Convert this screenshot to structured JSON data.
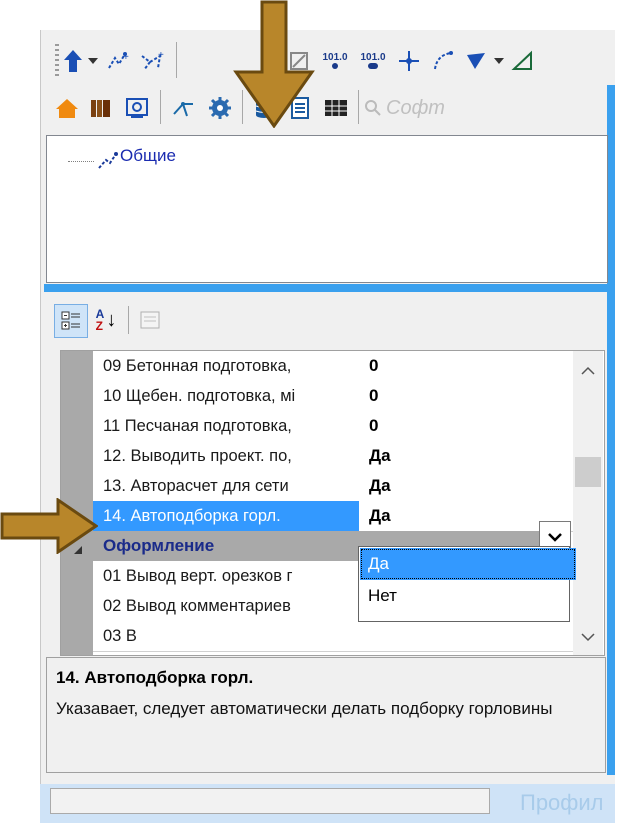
{
  "toolbar1": {
    "items": [
      {
        "icon": "up-arrow-icon"
      },
      {
        "icon": "dropdown-arrow-icon"
      },
      {
        "icon": "network-add-icon"
      },
      {
        "icon": "network-add2-icon"
      },
      {
        "icon": "edit-shape-icon"
      },
      {
        "icon": "label-101-icon",
        "text": "101.0"
      },
      {
        "icon": "label-101-b-icon",
        "text": "101.0"
      },
      {
        "icon": "crosshair-icon"
      },
      {
        "icon": "curve-icon"
      },
      {
        "icon": "triangle-icon"
      },
      {
        "icon": "dropdown-arrow2-icon"
      },
      {
        "icon": "measure-icon"
      }
    ]
  },
  "toolbar2": {
    "items": [
      {
        "icon": "home-icon"
      },
      {
        "icon": "books-icon"
      },
      {
        "icon": "picture-icon"
      },
      {
        "icon": "branch-icon"
      },
      {
        "icon": "settings-gear-icon"
      },
      {
        "icon": "database-icon"
      },
      {
        "icon": "document-icon"
      },
      {
        "icon": "table-icon"
      }
    ],
    "search_placeholder": "Софт"
  },
  "tree": {
    "items": [
      {
        "label": "Общие"
      }
    ]
  },
  "props_toolbar": {
    "icons": [
      "categorized-icon",
      "sort-az-icon",
      "property-pages-icon"
    ],
    "az": "A\nZ"
  },
  "grid": {
    "rows": [
      {
        "name": "09 Бетонная подготовка,",
        "value": "0"
      },
      {
        "name": "10 Щебен. подготовка, мі",
        "value": "0"
      },
      {
        "name": "11 Песчаная подготовка,",
        "value": "0"
      },
      {
        "name": "12. Выводить проект. по,",
        "value": "Да"
      },
      {
        "name": "13. Авторасчет для сети",
        "value": "Да"
      },
      {
        "name": "14. Автоподборка горл.",
        "value": "Да",
        "selected": true
      },
      {
        "category": "Оформление"
      },
      {
        "name": "01 Вывод верт. орезков г",
        "value": ""
      },
      {
        "name": "02 Вывод комментариев",
        "value": "0"
      },
      {
        "name": "03 В",
        "value": ""
      }
    ],
    "dropdown_options": [
      "Да",
      "Нет"
    ],
    "dropdown_selected": "Да"
  },
  "description": {
    "title": "14. Автоподборка горл.",
    "text": "Указавает, следует автоматически делать подборку горловины"
  },
  "status": {
    "text": "Профил"
  },
  "colors": {
    "accent": "#3aa0ee",
    "selection": "#3399ff",
    "arrow": "#b8862a",
    "category": "#1a2b8a"
  }
}
